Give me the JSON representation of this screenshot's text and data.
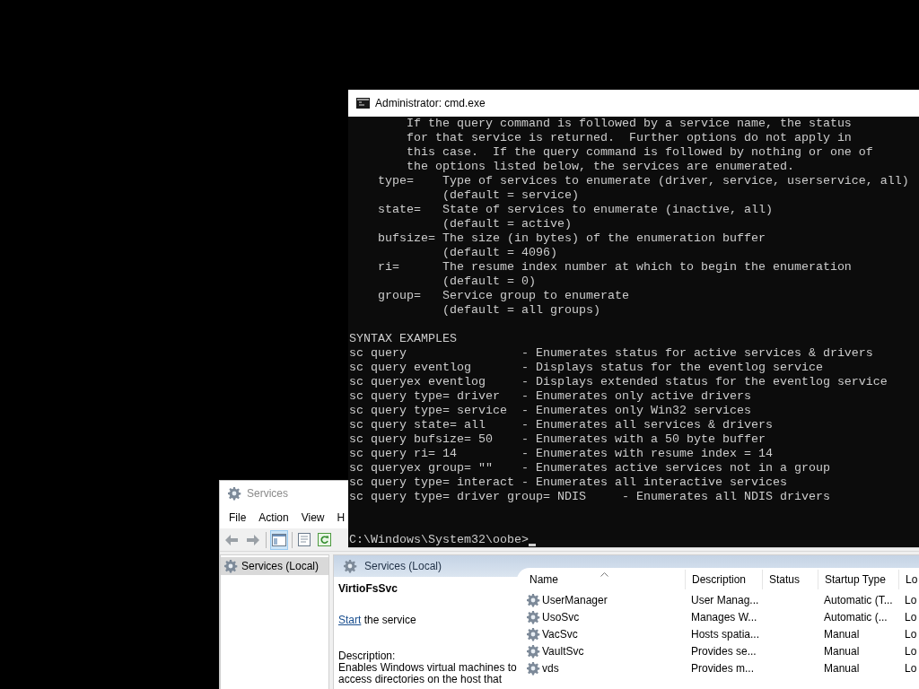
{
  "cmd": {
    "title": "Administrator: cmd.exe",
    "blocks": [
      [
        "        If the query command is followed by a service name, the status",
        "        for that service is returned.  Further options do not apply in",
        "        this case.  If the query command is followed by nothing or one of",
        "        the options listed below, the services are enumerated.",
        "    type=    Type of services to enumerate (driver, service, userservice, all)",
        "             (default = service)",
        "    state=   State of services to enumerate (inactive, all)",
        "             (default = active)",
        "    bufsize= The size (in bytes) of the enumeration buffer",
        "             (default = 4096)",
        "    ri=      The resume index number at which to begin the enumeration",
        "             (default = 0)",
        "    group=   Service group to enumerate",
        "             (default = all groups)"
      ],
      [
        "SYNTAX EXAMPLES",
        "sc query                - Enumerates status for active services & drivers",
        "sc query eventlog       - Displays status for the eventlog service",
        "sc queryex eventlog     - Displays extended status for the eventlog service",
        "sc query type= driver   - Enumerates only active drivers",
        "sc query type= service  - Enumerates only Win32 services",
        "sc query state= all     - Enumerates all services & drivers",
        "sc query bufsize= 50    - Enumerates with a 50 byte buffer",
        "sc query ri= 14         - Enumerates with resume index = 14",
        "sc queryex group= \"\"    - Enumerates active services not in a group",
        "sc query type= interact - Enumerates all interactive services",
        "sc query type= driver group= NDIS     - Enumerates all NDIS drivers"
      ]
    ],
    "prompt": "C:\\Windows\\System32\\oobe>"
  },
  "services": {
    "title": "Services",
    "menu": [
      "File",
      "Action",
      "View",
      "H"
    ],
    "toolbar": [
      {
        "kind": "back",
        "pressed": false
      },
      {
        "kind": "forward",
        "pressed": false
      },
      {
        "kind": "console-tree",
        "pressed": true
      },
      {
        "kind": "properties",
        "pressed": false
      },
      {
        "kind": "refresh",
        "pressed": false
      }
    ],
    "tree": [
      {
        "label": "Services (Local)",
        "selected": true
      }
    ],
    "pane_title": "Services (Local)",
    "detail": {
      "name": "VirtioFsSvc",
      "action_link": "Start",
      "action_rest": " the service",
      "description_label": "Description:",
      "description": "Enables Windows virtual machines to access directories on the host that"
    },
    "columns": [
      "Name",
      "Description",
      "Status",
      "Startup Type",
      "Lo"
    ],
    "rows": [
      {
        "name": "UserManager",
        "description": "User Manag...",
        "startup_type": "Automatic (T...",
        "column_5": "Lo"
      },
      {
        "name": "UsoSvc",
        "description": "Manages W...",
        "startup_type": "Automatic (...",
        "column_5": "Lo"
      },
      {
        "name": "VacSvc",
        "description": "Hosts spatia...",
        "startup_type": "Manual",
        "column_5": "Lo"
      },
      {
        "name": "VaultSvc",
        "description": "Provides se...",
        "startup_type": "Manual",
        "column_5": "Lo"
      },
      {
        "name": "vds",
        "description": "Provides m...",
        "startup_type": "Manual",
        "column_5": "Lo"
      }
    ]
  }
}
